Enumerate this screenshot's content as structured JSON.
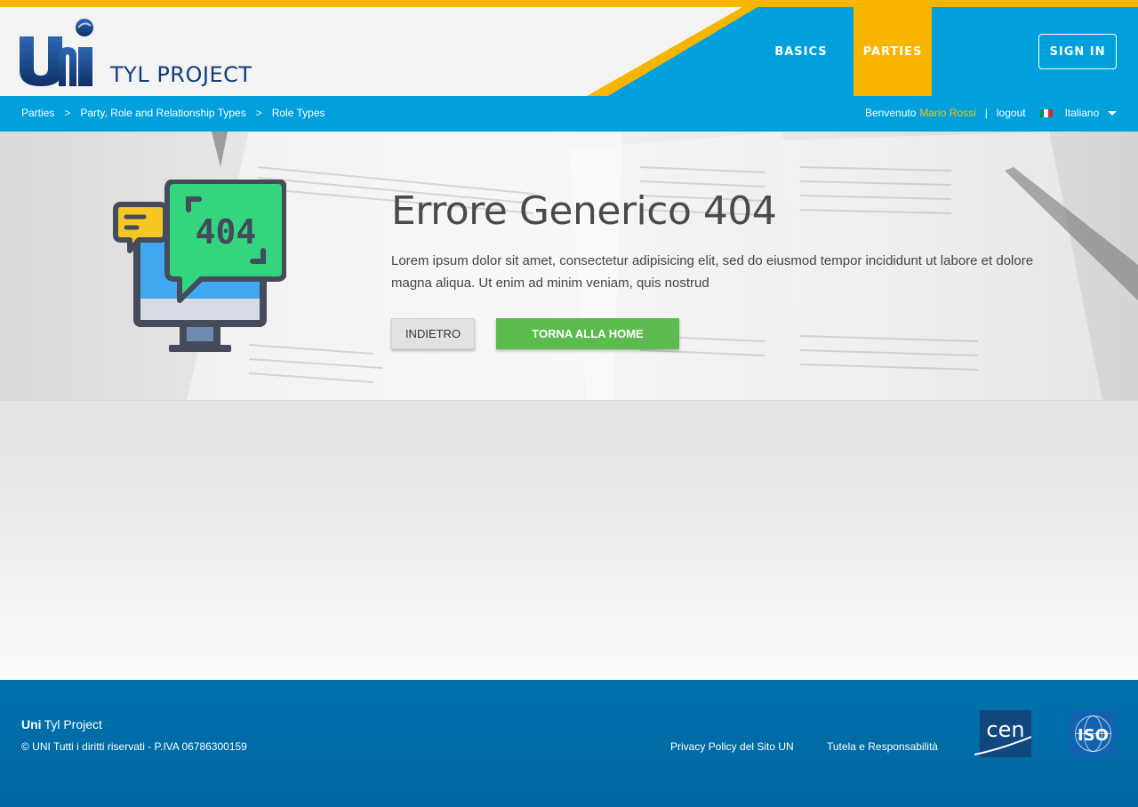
{
  "header": {
    "logo_text": "TYL PROJECT",
    "nav": [
      {
        "label": "BASICS",
        "active": false
      },
      {
        "label": "PARTIES",
        "active": true
      }
    ],
    "signin_label": "SIGN IN"
  },
  "breadcrumb": {
    "items": [
      "Parties",
      "Party, Role and Relationship Types",
      "Role Types"
    ],
    "separator": ">"
  },
  "user": {
    "welcome": "Benvenuto",
    "name": "Mario Rossi",
    "pipe": "|",
    "logout": "logout",
    "language": "Italiano"
  },
  "error": {
    "icon_text": "404",
    "title": "Errore Generico 404",
    "message": "Lorem ipsum dolor sit amet, consectetur adipisicing elit, sed do eiusmod tempor incididunt ut labore et dolore magna aliqua. Ut enim ad minim veniam, quis nostrud",
    "back_label": "INDIETRO",
    "home_label": "TORNA ALLA HOME"
  },
  "footer": {
    "brand_bold": "Uni",
    "brand_rest": "Tyl Project",
    "copyright": "© UNI Tutti i diritti riservati - P.IVA 06786300159",
    "links": [
      "Privacy Policy del Sito UN",
      "Tutela e Responsabilità"
    ],
    "cen_text": "cen",
    "iso_text": "ISO"
  },
  "colors": {
    "accent_yellow": "#f7b500",
    "primary_blue": "#00a0dc",
    "footer_blue": "#0072ae",
    "home_green": "#5cbb4f"
  }
}
